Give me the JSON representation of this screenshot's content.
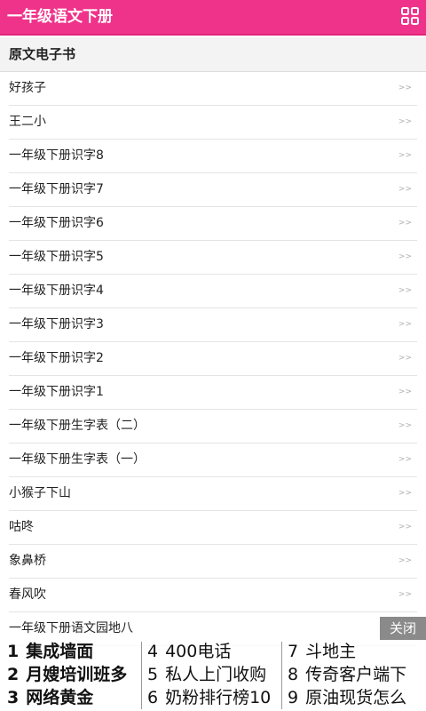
{
  "header": {
    "title": "一年级语文下册",
    "menu_icon": "grid-icon",
    "color": "#f0338a"
  },
  "section": {
    "title": "原文电子书"
  },
  "list": {
    "arrow": ">>",
    "items": [
      "好孩子",
      "王二小",
      "一年级下册识字8",
      "一年级下册识字7",
      "一年级下册识字6",
      "一年级下册识字5",
      "一年级下册识字4",
      "一年级下册识字3",
      "一年级下册识字2",
      "一年级下册识字1",
      "一年级下册生字表（二）",
      "一年级下册生字表（一）",
      "小猴子下山",
      "咕咚",
      "象鼻桥",
      "春风吹",
      "一年级下册语文园地八"
    ]
  },
  "ad": {
    "close_label": "关闭",
    "col1": [
      {
        "n": "1",
        "t": "集成墙面"
      },
      {
        "n": "2",
        "t": "月嫂培训班多"
      },
      {
        "n": "3",
        "t": "网络黄金"
      }
    ],
    "col2": [
      {
        "n": "4",
        "t": "400电话"
      },
      {
        "n": "5",
        "t": "私人上门收购"
      },
      {
        "n": "6",
        "t": "奶粉排行榜10"
      }
    ],
    "col3": [
      {
        "n": "7",
        "t": "斗地主"
      },
      {
        "n": "8",
        "t": "传奇客户端下"
      },
      {
        "n": "9",
        "t": "原油现货怎么"
      }
    ]
  }
}
